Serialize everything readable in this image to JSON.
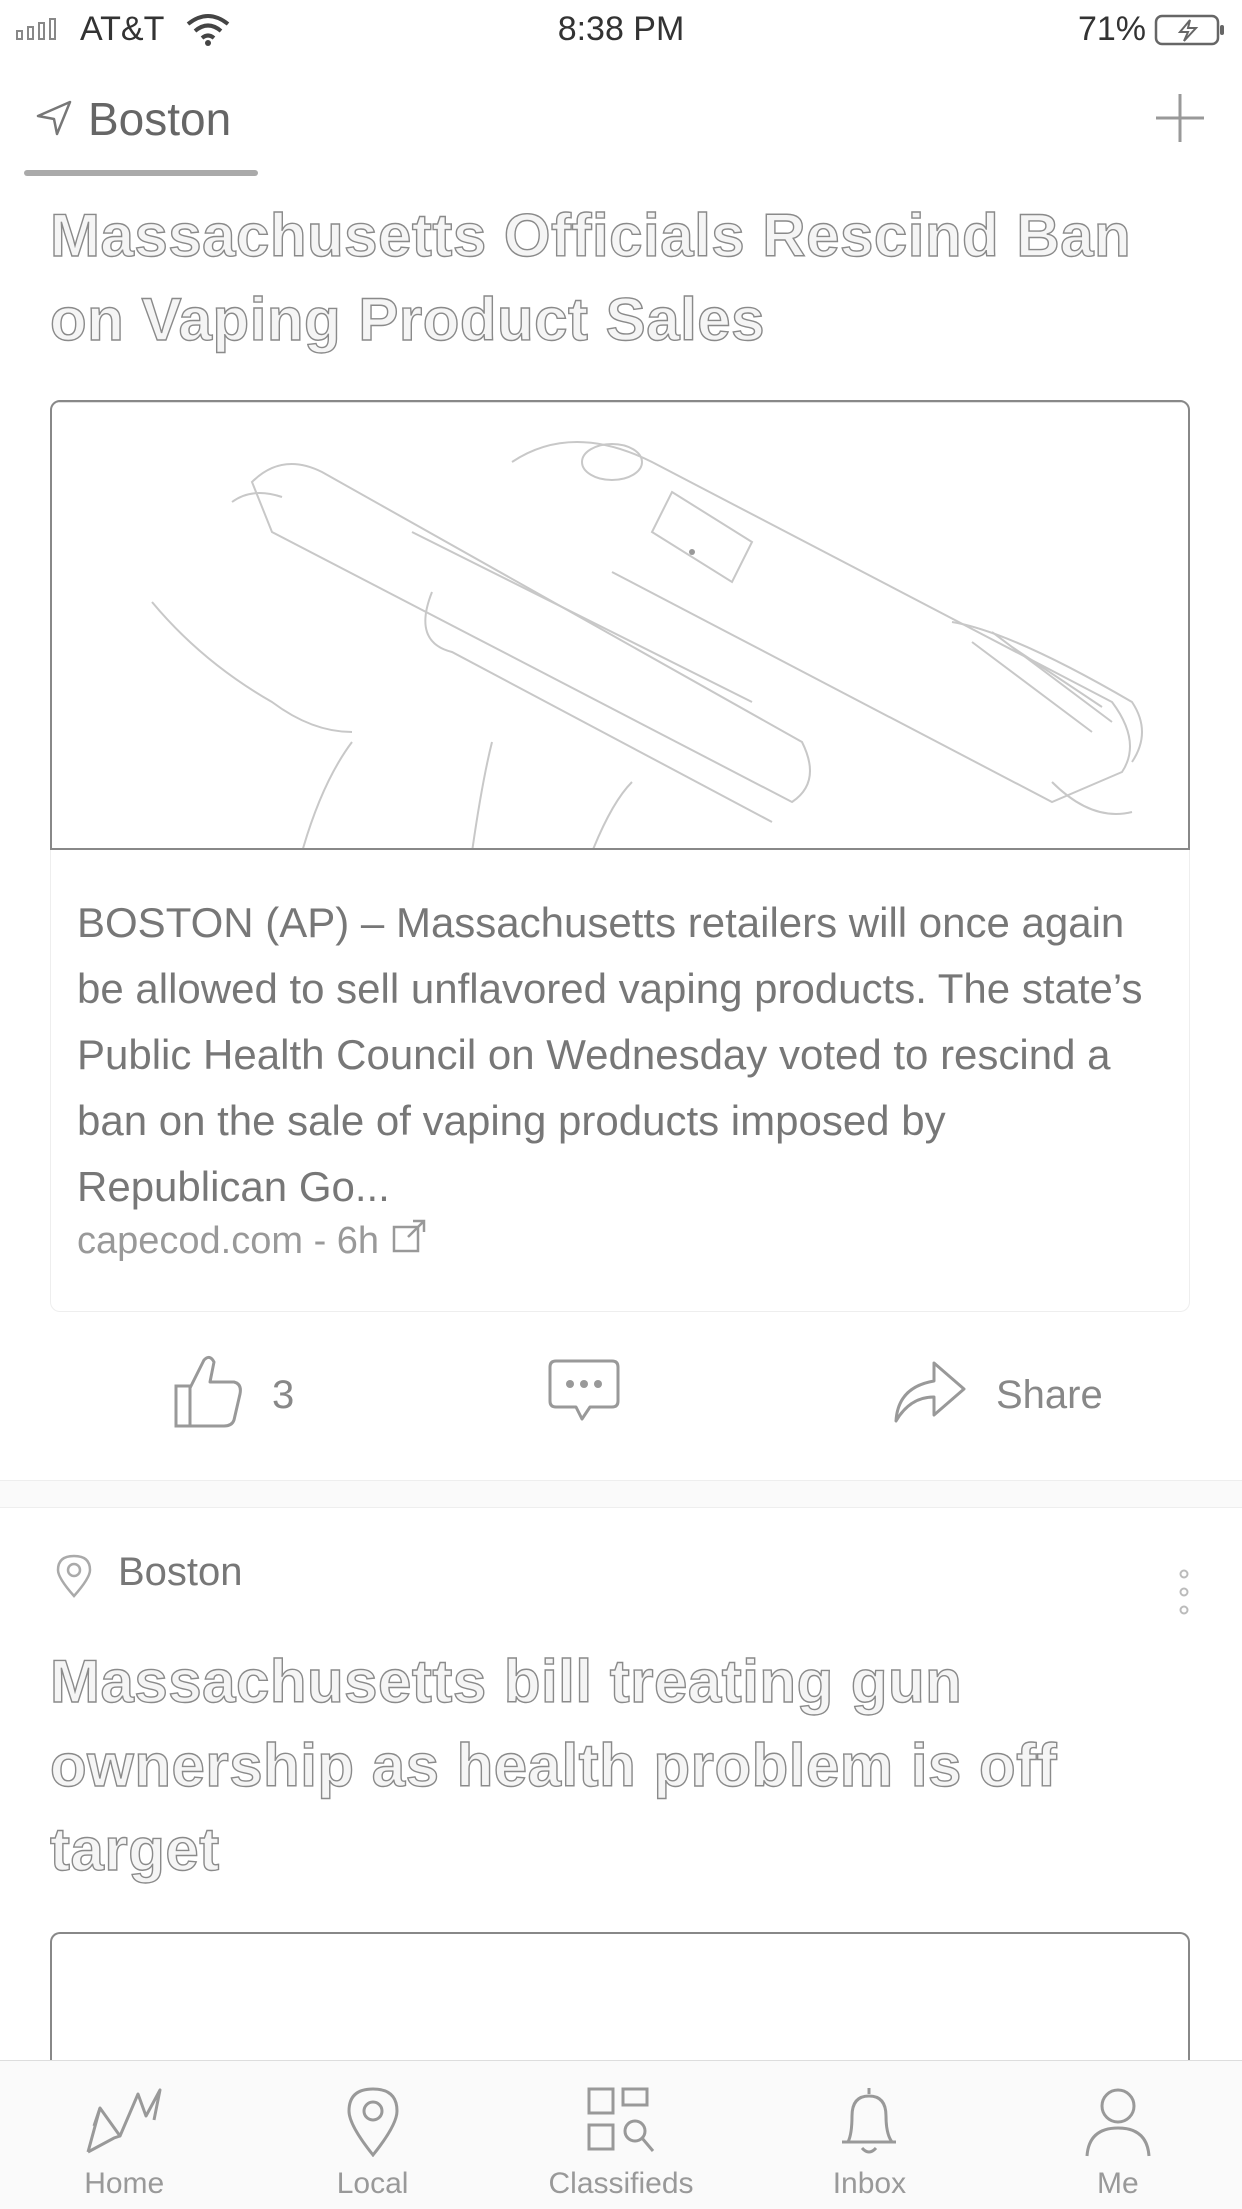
{
  "status_bar": {
    "carrier": "AT&T",
    "time": "8:38 PM",
    "battery": "71%"
  },
  "header": {
    "location": "Boston"
  },
  "article1": {
    "title": "Massachusetts Officials Rescind Ban on Vaping Product Sales",
    "summary": "BOSTON (AP) – Massachusetts retailers will once again be allowed to sell unflavored vaping products. The state’s Public Health Council on Wednesday voted to rescind a ban on the sale of vaping products imposed by Republican Go...",
    "source": "capecod.com - 6h",
    "likes": "3",
    "share_label": "Share"
  },
  "article2": {
    "location": "Boston",
    "title": "Massachusetts bill treating gun ownership as health problem is off target"
  },
  "tabs": [
    {
      "label": "Home",
      "icon": "home-icon"
    },
    {
      "label": "Local",
      "icon": "local-pin-icon"
    },
    {
      "label": "Classifieds",
      "icon": "classifieds-icon"
    },
    {
      "label": "Inbox",
      "icon": "bell-icon"
    },
    {
      "label": "Me",
      "icon": "person-icon"
    }
  ]
}
